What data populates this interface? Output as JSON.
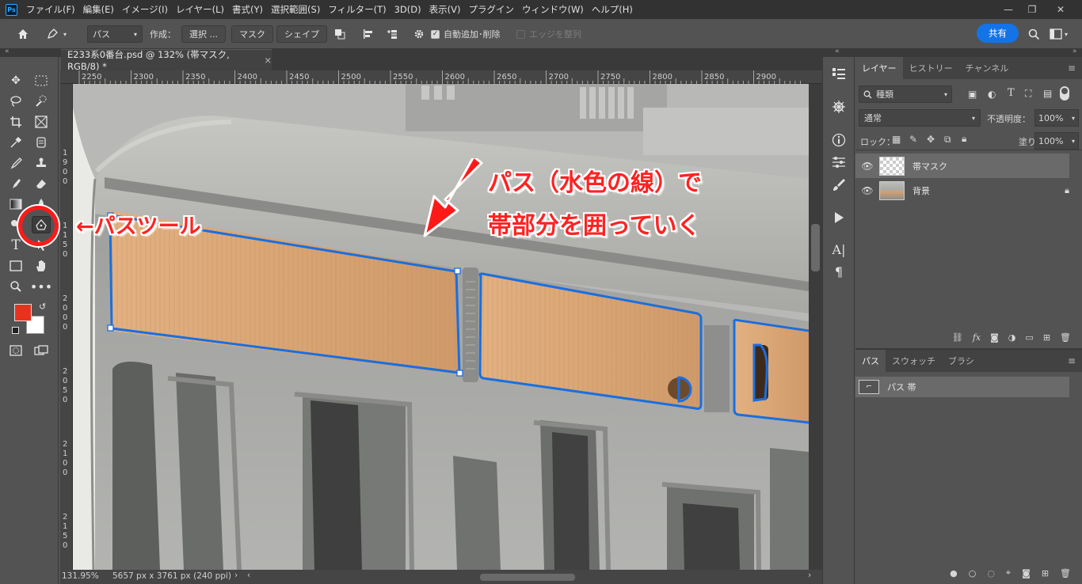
{
  "app": {
    "logo_text": "Ps",
    "menu": [
      "ファイル(F)",
      "編集(E)",
      "イメージ(I)",
      "レイヤー(L)",
      "書式(Y)",
      "選択範囲(S)",
      "フィルター(T)",
      "3D(D)",
      "表示(V)",
      "プラグイン",
      "ウィンドウ(W)",
      "ヘルプ(H)"
    ],
    "window_controls": [
      "—",
      "❐",
      "✕"
    ]
  },
  "options": {
    "mode_select": "パス",
    "create_label": "作成：",
    "select_btn": "選択 ...",
    "mask_btn": "マスク",
    "shape_btn": "シェイプ",
    "auto_add_delete": "自動追加･削除",
    "align_edges": "エッジを整列",
    "share": "共有"
  },
  "document": {
    "tab_title": "E233系0番台.psd @ 132% (帯マスク, RGB/8) *",
    "close": "×",
    "ruler_h": [
      "2250",
      "2300",
      "2350",
      "2400",
      "2450",
      "2500",
      "2550",
      "2600",
      "2650",
      "2700",
      "2750",
      "2800",
      "2850",
      "2900"
    ],
    "ruler_v": [
      [
        "1",
        "9",
        "0",
        "0"
      ],
      [
        "1",
        "1",
        "5",
        "0"
      ],
      [
        "2",
        "0",
        "0",
        "0"
      ],
      [
        "2",
        "0",
        "5",
        "0"
      ],
      [
        "2",
        "1",
        "0",
        "0"
      ],
      [
        "2",
        "1",
        "5",
        "0"
      ]
    ],
    "zoom": "131.95%",
    "doc_info": "5657 px x 3761 px (240 ppi)"
  },
  "annotations": {
    "pen_tool_label": "←パスツール",
    "instruction_line1": "パス（水色の線）で",
    "instruction_line2": "帯部分を囲っていく"
  },
  "layers_panel": {
    "tabs": [
      "レイヤー",
      "ヒストリー",
      "チャンネル"
    ],
    "kind_filter": "種類",
    "blend_mode": "通常",
    "opacity_label": "不透明度：",
    "opacity_value": "100%",
    "lock_label": "ロック：",
    "fill_label": "塗り：",
    "fill_value": "100%",
    "layers": [
      {
        "name": "帯マスク",
        "selected": true
      },
      {
        "name": "背景",
        "locked": true
      }
    ]
  },
  "paths_panel": {
    "tabs": [
      "パス",
      "スウォッチ",
      "ブラシ"
    ],
    "items": [
      {
        "name": "パス 帯"
      }
    ]
  },
  "colors": {
    "foreground": "#e8321e",
    "background": "#ffffff",
    "accent": "#1473e6",
    "path_stroke": "#1a6fe0"
  }
}
